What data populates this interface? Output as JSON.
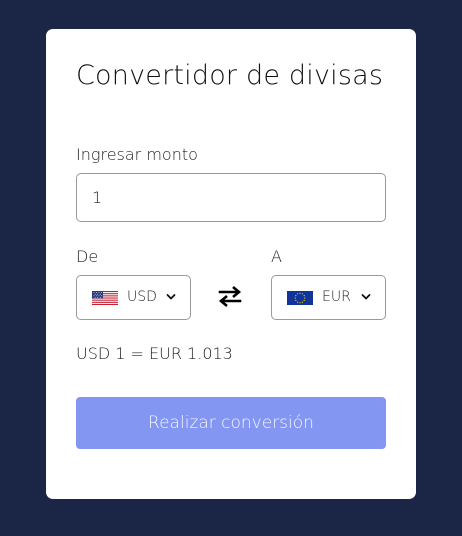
{
  "converter": {
    "title": "Convertidor de divisas",
    "amount_label": "Ingresar monto",
    "amount_value": "1",
    "from_label": "De",
    "to_label": "A",
    "from_currency": {
      "code": "USD",
      "flag_icon": "us-flag-icon"
    },
    "to_currency": {
      "code": "EUR",
      "flag_icon": "eu-flag-icon"
    },
    "swap_icon": "swap-arrows-icon",
    "rate_text": "USD 1 = EUR 1.013",
    "convert_button_label": "Realizar conversión"
  },
  "colors": {
    "background": "#1b2647",
    "card": "#ffffff",
    "button": "#8396f2",
    "border": "#9a9a9a"
  }
}
